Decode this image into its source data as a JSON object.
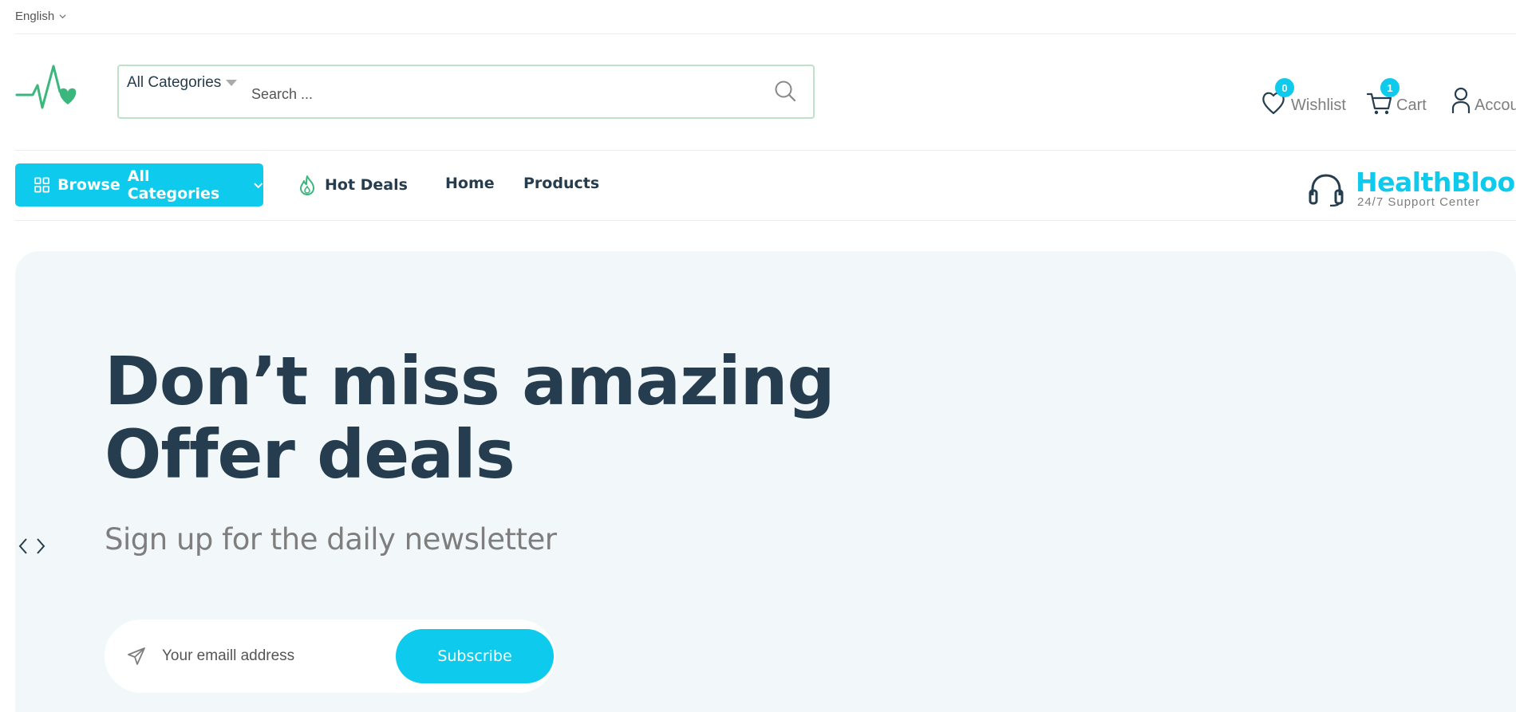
{
  "topbar": {
    "language": "English"
  },
  "header": {
    "search": {
      "category": "All Categories",
      "placeholder": "Search ..."
    },
    "wishlist": {
      "label": "Wishlist",
      "count": "0"
    },
    "cart": {
      "label": "Cart",
      "count": "1"
    },
    "account": {
      "label": "Account"
    }
  },
  "nav": {
    "browse_label_1": "Browse",
    "browse_label_2": "All Categories",
    "links": [
      {
        "label": "Hot Deals"
      },
      {
        "label": "Home"
      },
      {
        "label": "Products"
      }
    ],
    "support": {
      "brand": "HealthBloom",
      "subtitle": "24/7 Support Center"
    }
  },
  "hero": {
    "title_line1": "Don’t miss amazing",
    "title_line2": "Offer deals",
    "subtitle": "Sign up for the daily newsletter",
    "email_placeholder": "Your emaill address",
    "subscribe_label": "Subscribe"
  },
  "colors": {
    "accent": "#0ECAEC",
    "heading": "#253D4E",
    "logo_green": "#3BB77E"
  },
  "icons": [
    "chevron-down-icon",
    "logo-icon",
    "search-icon",
    "heart-icon",
    "cart-icon",
    "user-icon",
    "grid-icon",
    "fire-icon",
    "headphones-icon",
    "chevron-left-icon",
    "chevron-right-icon",
    "send-icon"
  ]
}
